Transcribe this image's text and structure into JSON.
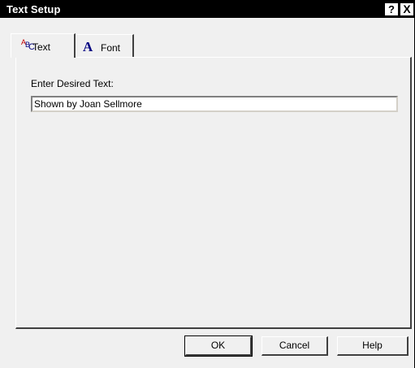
{
  "window": {
    "title": "Text Setup",
    "help_glyph": "?",
    "close_glyph": "X"
  },
  "tabs": [
    {
      "label": "Text",
      "icon": "abc-icon",
      "active": true
    },
    {
      "label": "Font",
      "icon": "font-icon",
      "active": false
    }
  ],
  "icons": {
    "abc": {
      "a": "A",
      "b": "B",
      "c": "C"
    },
    "font": "A"
  },
  "text_tab": {
    "field_label": "Enter Desired Text:",
    "field_value": "Shown by Joan Sellmore"
  },
  "buttons": {
    "ok": "OK",
    "cancel": "Cancel",
    "help": "Help"
  }
}
